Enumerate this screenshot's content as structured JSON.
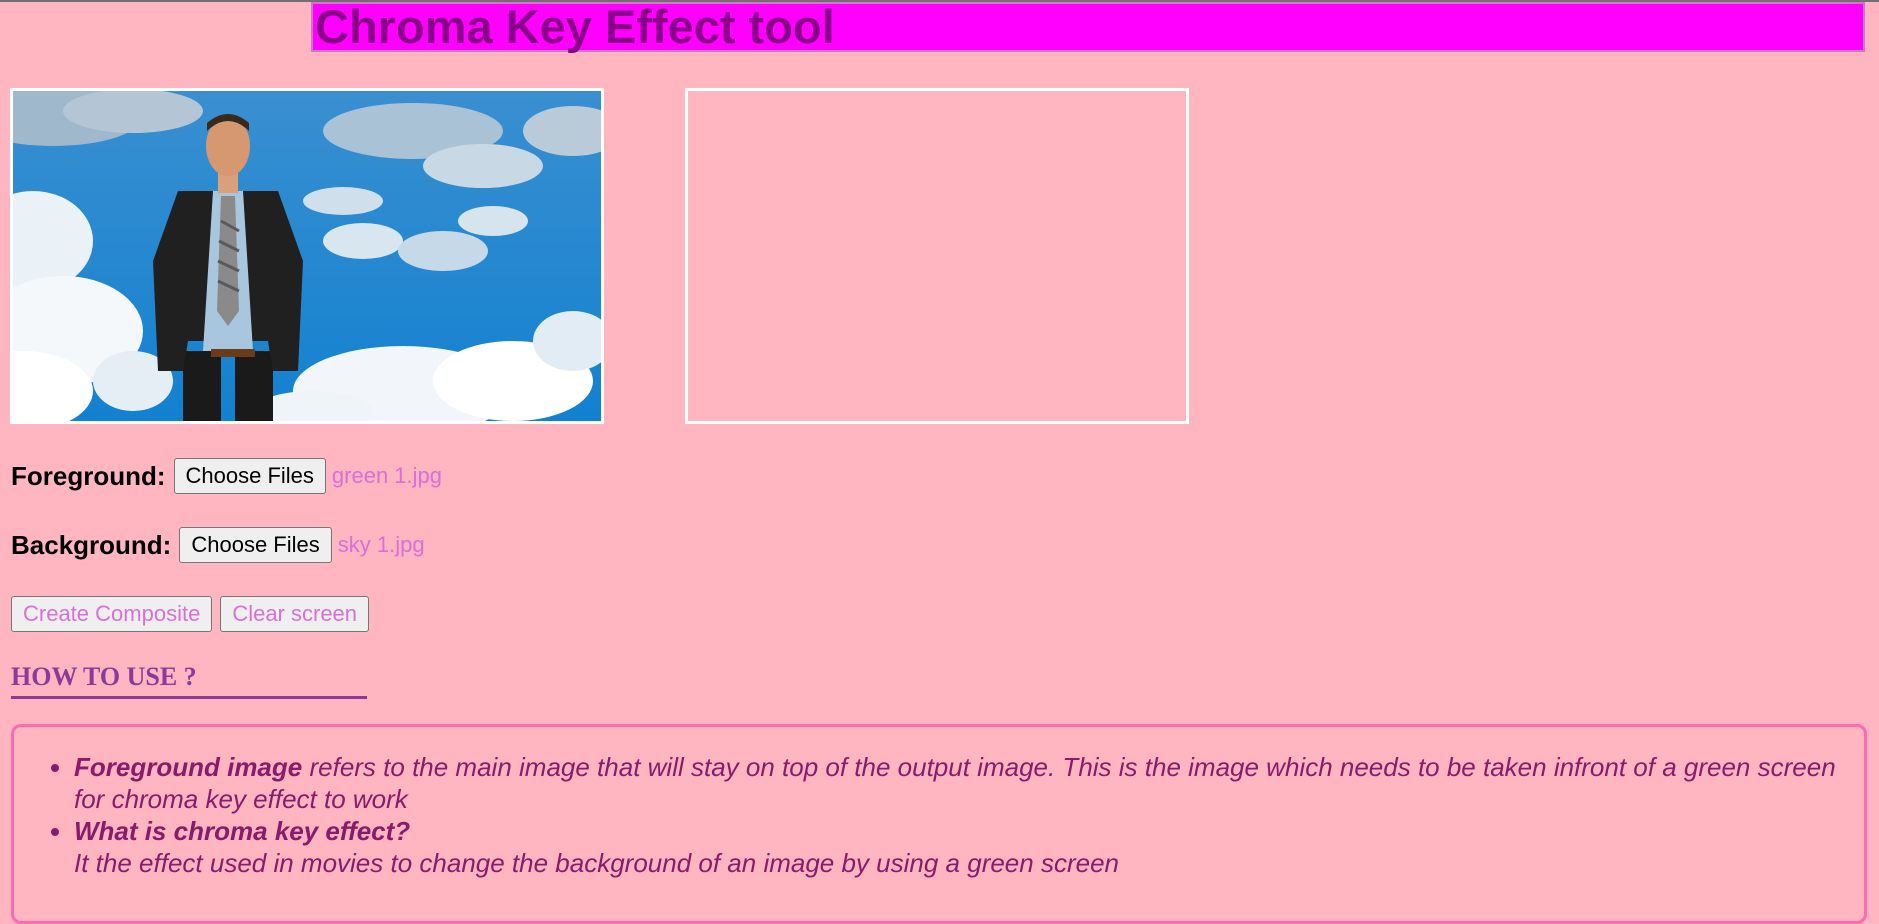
{
  "page": {
    "title": "Chroma Key Effect tool"
  },
  "controls": {
    "foreground_label": "Foreground:",
    "foreground_button": "Choose Files",
    "foreground_file": "green 1.jpg",
    "background_label": "Background:",
    "background_button": "Choose Files",
    "background_file": "sky 1.jpg",
    "create_button": "Create Composite",
    "clear_button": "Clear screen"
  },
  "howto": {
    "heading": "HOW TO USE ?",
    "items": [
      {
        "term": "Foreground image",
        "text": " refers to the main image that will stay on top of the output image. This is the image which needs to be taken infront of a green screen for chroma key effect to work"
      },
      {
        "term": "What is chroma key effect?",
        "text": "It the effect used in movies to change the background of an image by using a green screen"
      }
    ]
  },
  "colors": {
    "page_background": "#ffb6c1",
    "title_background": "#ff00ff",
    "title_text": "#8b008b",
    "file_name_text": "#da70d6",
    "info_border": "#ff69b4"
  }
}
